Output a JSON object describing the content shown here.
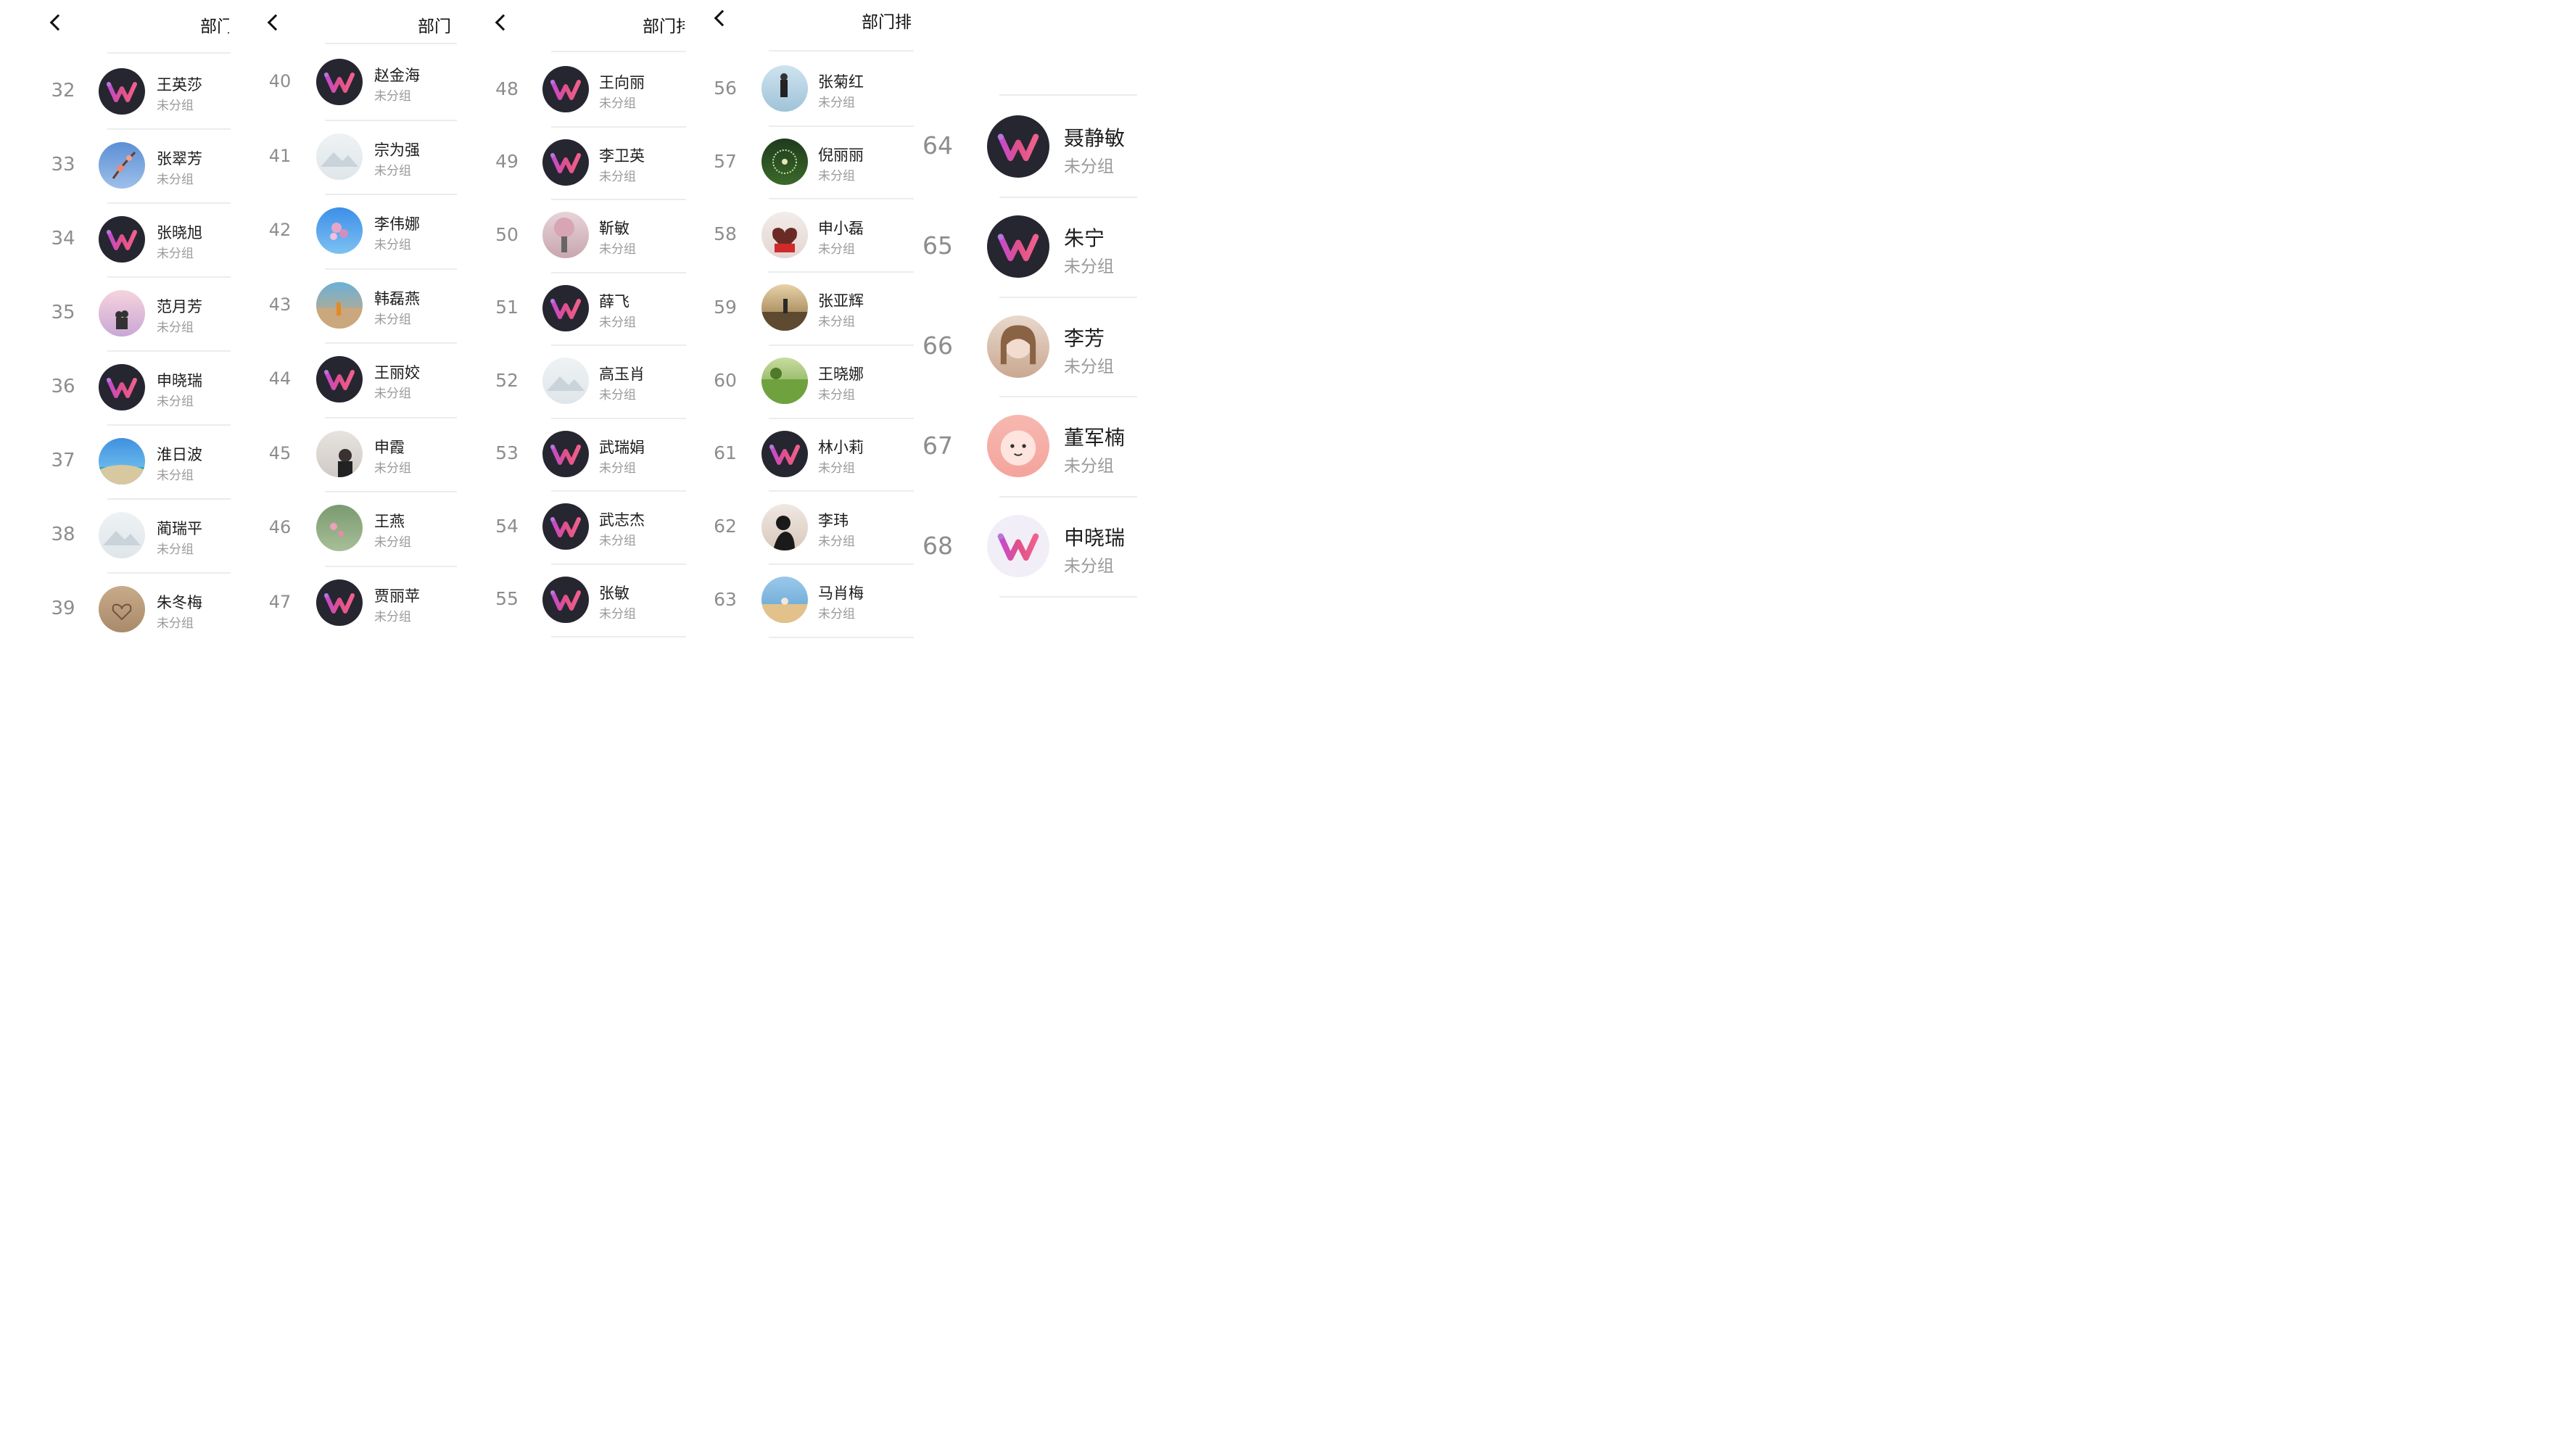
{
  "screens": [
    {
      "title": "部门",
      "rows": [
        {
          "rank": "32",
          "name": "王英莎",
          "group": "未分组",
          "avatar": "w-logo-icon"
        },
        {
          "rank": "33",
          "name": "张翠芳",
          "group": "未分组",
          "avatar": "flower-branch-photo"
        },
        {
          "rank": "34",
          "name": "张晓旭",
          "group": "未分组",
          "avatar": "w-logo-icon"
        },
        {
          "rank": "35",
          "name": "范月芳",
          "group": "未分组",
          "avatar": "couple-photo"
        },
        {
          "rank": "36",
          "name": "申晓瑞",
          "group": "未分组",
          "avatar": "w-logo-icon"
        },
        {
          "rank": "37",
          "name": "淮日波",
          "group": "未分组",
          "avatar": "seaside-photo"
        },
        {
          "rank": "38",
          "name": "蔺瑞平",
          "group": "未分组",
          "avatar": "placeholder-mountain-icon"
        },
        {
          "rank": "39",
          "name": "朱冬梅",
          "group": "未分组",
          "avatar": "sand-heart-photo"
        }
      ]
    },
    {
      "title": "部门",
      "rows": [
        {
          "rank": "40",
          "name": "赵金海",
          "group": "未分组",
          "avatar": "w-logo-icon"
        },
        {
          "rank": "41",
          "name": "宗为强",
          "group": "未分组",
          "avatar": "placeholder-mountain-icon"
        },
        {
          "rank": "42",
          "name": "李伟娜",
          "group": "未分组",
          "avatar": "blossom-photo"
        },
        {
          "rank": "43",
          "name": "韩磊燕",
          "group": "未分组",
          "avatar": "beach-person-photo"
        },
        {
          "rank": "44",
          "name": "王丽姣",
          "group": "未分组",
          "avatar": "w-logo-icon"
        },
        {
          "rank": "45",
          "name": "申霞",
          "group": "未分组",
          "avatar": "portrait-photo"
        },
        {
          "rank": "46",
          "name": "王燕",
          "group": "未分组",
          "avatar": "green-blossom-photo"
        },
        {
          "rank": "47",
          "name": "贾丽苹",
          "group": "未分组",
          "avatar": "w-logo-icon"
        }
      ]
    },
    {
      "title": "部门排",
      "rows": [
        {
          "rank": "48",
          "name": "王向丽",
          "group": "未分组",
          "avatar": "w-logo-icon"
        },
        {
          "rank": "49",
          "name": "李卫英",
          "group": "未分组",
          "avatar": "w-logo-icon"
        },
        {
          "rank": "50",
          "name": "靳敏",
          "group": "未分组",
          "avatar": "cherry-tree-photo"
        },
        {
          "rank": "51",
          "name": "薛飞",
          "group": "未分组",
          "avatar": "w-logo-icon"
        },
        {
          "rank": "52",
          "name": "高玉肖",
          "group": "未分组",
          "avatar": "placeholder-mountain-icon"
        },
        {
          "rank": "53",
          "name": "武瑞娟",
          "group": "未分组",
          "avatar": "w-logo-icon"
        },
        {
          "rank": "54",
          "name": "武志杰",
          "group": "未分组",
          "avatar": "w-logo-icon"
        },
        {
          "rank": "55",
          "name": "张敏",
          "group": "未分组",
          "avatar": "w-logo-icon"
        }
      ]
    },
    {
      "title": "部门排",
      "rows": [
        {
          "rank": "56",
          "name": "张菊红",
          "group": "未分组",
          "avatar": "skater-photo"
        },
        {
          "rank": "57",
          "name": "倪丽丽",
          "group": "未分组",
          "avatar": "dandelion-photo"
        },
        {
          "rank": "58",
          "name": "申小磊",
          "group": "未分组",
          "avatar": "red-heart-photo"
        },
        {
          "rank": "59",
          "name": "张亚辉",
          "group": "未分组",
          "avatar": "sunset-runner-photo"
        },
        {
          "rank": "60",
          "name": "王晓娜",
          "group": "未分组",
          "avatar": "grass-field-photo"
        },
        {
          "rank": "61",
          "name": "林小莉",
          "group": "未分组",
          "avatar": "w-logo-icon"
        },
        {
          "rank": "62",
          "name": "李玮",
          "group": "未分组",
          "avatar": "silhouette-photo"
        },
        {
          "rank": "63",
          "name": "马肖梅",
          "group": "未分组",
          "avatar": "lake-child-photo"
        }
      ]
    },
    {
      "rows": [
        {
          "rank": "64",
          "name": "聂静敏",
          "group": "未分组",
          "avatar": "w-logo-icon"
        },
        {
          "rank": "65",
          "name": "朱宁",
          "group": "未分组",
          "avatar": "w-logo-icon"
        },
        {
          "rank": "66",
          "name": "李芳",
          "group": "未分组",
          "avatar": "girl-portrait-photo"
        },
        {
          "rank": "67",
          "name": "董军楠",
          "group": "未分组",
          "avatar": "pink-cartoon-icon"
        },
        {
          "rank": "68",
          "name": "申晓瑞",
          "group": "未分组",
          "avatar": "w-logo-light-icon"
        }
      ]
    }
  ]
}
